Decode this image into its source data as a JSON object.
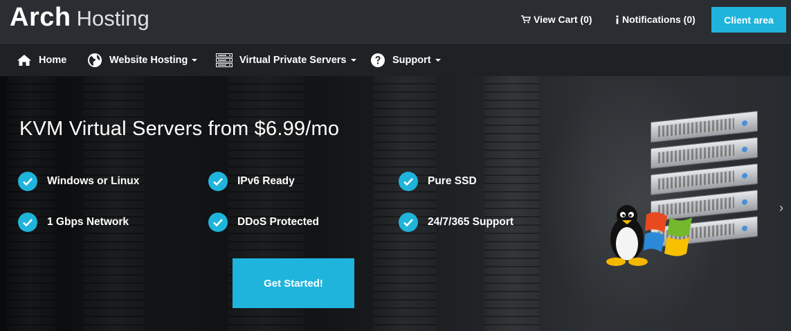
{
  "brand": {
    "part1": "Arch",
    "part2": "Hosting"
  },
  "top": {
    "cart_label": "View Cart (0)",
    "notifications_label": "Notifications (0)",
    "client_area_label": "Client area"
  },
  "nav": {
    "items": [
      {
        "label": "Home",
        "icon": "home-icon",
        "dropdown": false
      },
      {
        "label": "Website Hosting",
        "icon": "globe-icon",
        "dropdown": true
      },
      {
        "label": "Virtual Private Servers",
        "icon": "server-icon",
        "dropdown": true
      },
      {
        "label": "Support",
        "icon": "question-icon",
        "dropdown": true
      }
    ]
  },
  "hero": {
    "headline": "KVM Virtual Servers from $6.99/mo",
    "features": [
      "Windows or Linux",
      "IPv6 Ready",
      "Pure SSD",
      "1 Gbps Network",
      "DDoS Protected",
      "24/7/365 Support"
    ],
    "cta_label": "Get Started!",
    "next_arrow": "›"
  },
  "colors": {
    "accent": "#1fb4dc",
    "topbar": "#2a2d31",
    "navbar": "#1f2225"
  }
}
